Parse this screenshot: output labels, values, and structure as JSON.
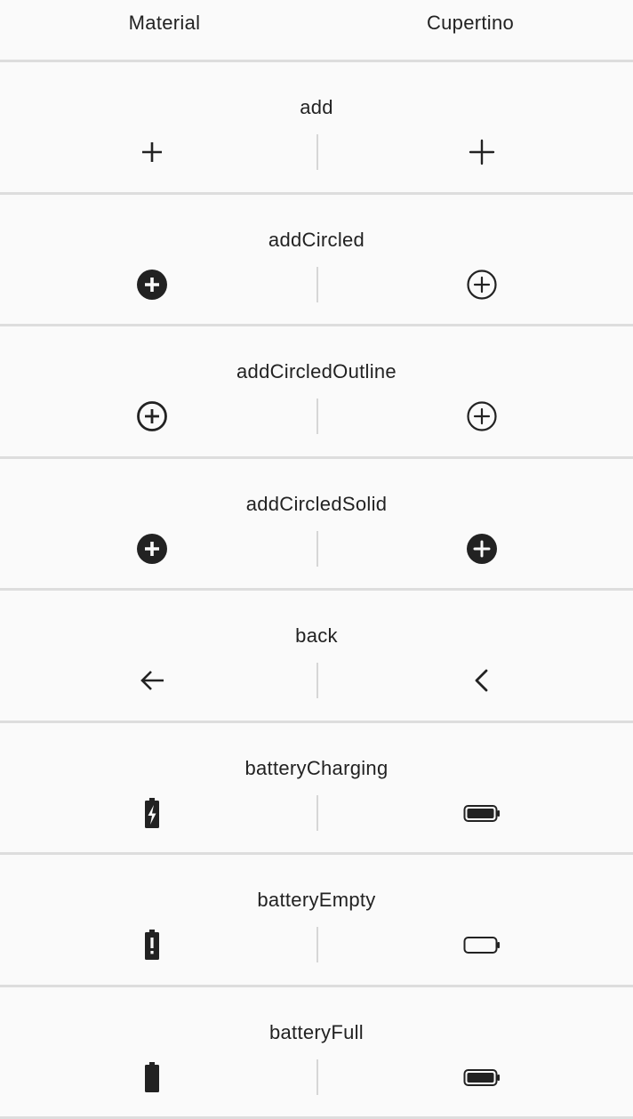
{
  "header": {
    "material_label": "Material",
    "cupertino_label": "Cupertino"
  },
  "rows": [
    {
      "name": "add",
      "material_icon": "add-icon",
      "cupertino_icon": "add-icon"
    },
    {
      "name": "addCircled",
      "material_icon": "add-circle-solid-icon",
      "cupertino_icon": "add-circle-outline-icon"
    },
    {
      "name": "addCircledOutline",
      "material_icon": "add-circle-outline-icon",
      "cupertino_icon": "add-circle-outline-icon"
    },
    {
      "name": "addCircledSolid",
      "material_icon": "add-circle-solid-icon",
      "cupertino_icon": "add-circle-solid-icon"
    },
    {
      "name": "back",
      "material_icon": "arrow-back-icon",
      "cupertino_icon": "chevron-back-icon"
    },
    {
      "name": "batteryCharging",
      "material_icon": "battery-charging-icon",
      "cupertino_icon": "battery-full-horizontal-icon"
    },
    {
      "name": "batteryEmpty",
      "material_icon": "battery-alert-icon",
      "cupertino_icon": "battery-empty-horizontal-icon"
    },
    {
      "name": "batteryFull",
      "material_icon": "battery-full-icon",
      "cupertino_icon": "battery-full-horizontal-icon"
    }
  ],
  "colors": {
    "background": "#fafafa",
    "text": "#222222",
    "divider": "#dddddd"
  }
}
